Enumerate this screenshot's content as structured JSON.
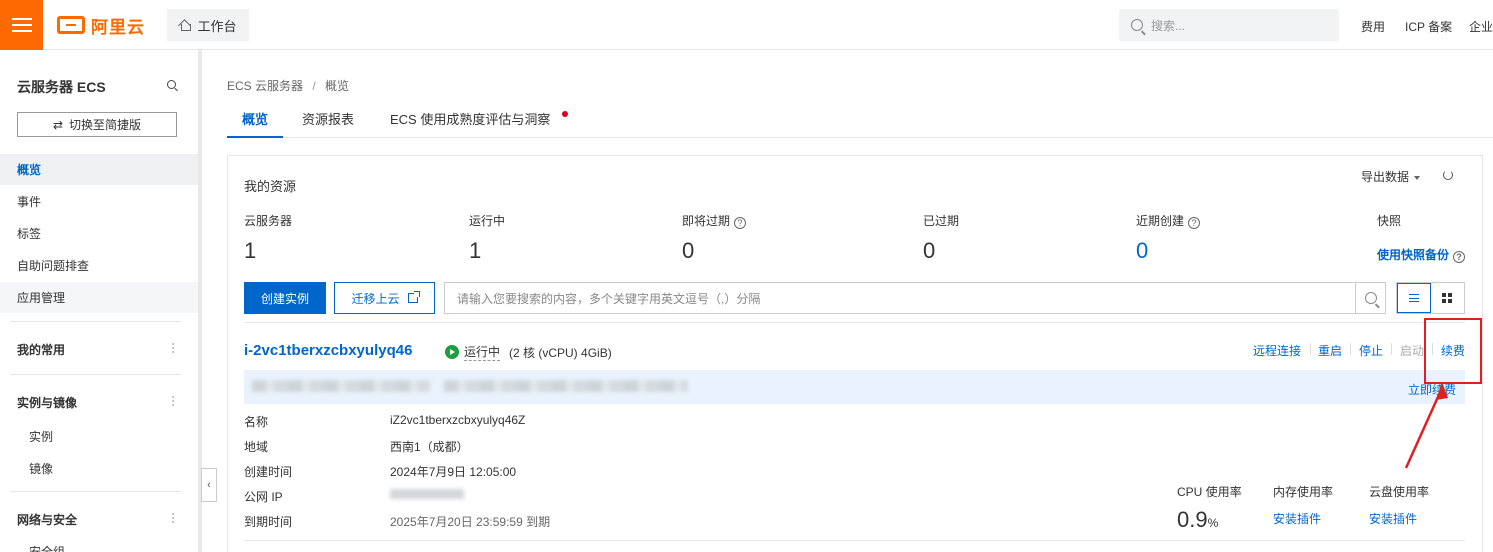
{
  "topbar": {
    "brand": "阿里云",
    "workbench": "工作台",
    "search_placeholder": "搜索...",
    "links": [
      "费用",
      "ICP 备案",
      "企业"
    ]
  },
  "sidebar": {
    "title": "云服务器 ECS",
    "switch_label": "切换至简捷版",
    "items": [
      {
        "label": "概览",
        "active": true
      },
      {
        "label": "事件"
      },
      {
        "label": "标签"
      },
      {
        "label": "自助问题排查"
      },
      {
        "label": "应用管理"
      }
    ],
    "groups": [
      {
        "label": "我的常用",
        "children": []
      },
      {
        "label": "实例与镜像",
        "children": [
          "实例",
          "镜像"
        ]
      },
      {
        "label": "网络与安全",
        "children": [
          "安全组"
        ]
      }
    ]
  },
  "breadcrumb": [
    "ECS 云服务器",
    "/",
    "概览"
  ],
  "tabs": [
    {
      "label": "概览",
      "active": true
    },
    {
      "label": "资源报表"
    },
    {
      "label": "ECS 使用成熟度评估与洞察"
    }
  ],
  "resources": {
    "title": "我的资源",
    "export_label": "导出数据",
    "stats": [
      {
        "label": "云服务器",
        "value": "1"
      },
      {
        "label": "运行中",
        "value": "1"
      },
      {
        "label": "即将过期",
        "value": "0",
        "help": "?"
      },
      {
        "label": "已过期",
        "value": "0"
      },
      {
        "label": "近期创建",
        "value": "0",
        "help": "?"
      },
      {
        "label": "快照",
        "link": "使用快照备份",
        "help": "?"
      }
    ]
  },
  "toolbar": {
    "create_label": "创建实例",
    "migrate_label": "迁移上云",
    "filter_placeholder": "请输入您要搜索的内容，多个关键字用英文逗号（,）分隔"
  },
  "instance": {
    "id": "i-2vc1tberxzcbxyulyq46",
    "status": "运行中",
    "spec": "(2 核 (vCPU) 4GiB)",
    "actions": [
      "远程连接",
      "重启",
      "停止",
      "启动",
      "续费"
    ],
    "renew_now": "立即续费",
    "details": [
      {
        "label": "名称",
        "value": "iZ2vc1tberxzcbxyulyq46Z"
      },
      {
        "label": "地域",
        "value": "西南1（成都）"
      },
      {
        "label": "创建时间",
        "value": "2024年7月9日 12:05:00"
      },
      {
        "label": "公网 IP",
        "value": ""
      },
      {
        "label": "到期时间",
        "value": "2025年7月20日 23:59:59  到期"
      }
    ],
    "metrics": [
      {
        "label": "CPU 使用率",
        "value": "0.9",
        "unit": "%"
      },
      {
        "label": "内存使用率",
        "link": "安装插件"
      },
      {
        "label": "云盘使用率",
        "link": "安装插件"
      }
    ]
  },
  "colors": {
    "brand_orange": "#ff6a00",
    "primary_blue": "#0066cc",
    "running_green": "#1a9e3f",
    "annotation_red": "#e02020"
  }
}
